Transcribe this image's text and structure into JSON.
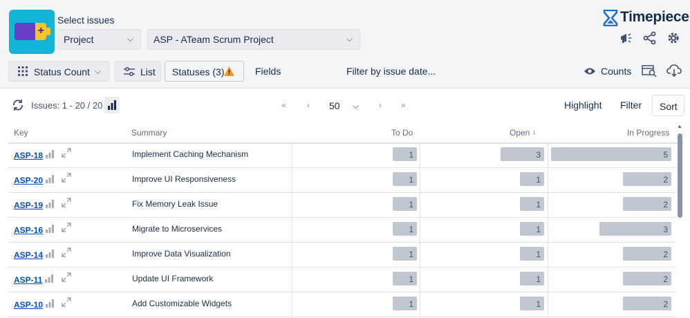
{
  "header": {
    "select_label": "Select issues",
    "project_dropdown": "Project",
    "project_value": "ASP - ATeam Scrum Project",
    "brand": "Timepiece"
  },
  "toolbar": {
    "status_count": "Status Count",
    "list": "List",
    "statuses": "Statuses (3)",
    "fields": "Fields",
    "filter_date": "Filter by issue date...",
    "counts": "Counts"
  },
  "pager": {
    "issues": "Issues: 1 - 20 / 20",
    "page_size": "50",
    "highlight": "Highlight",
    "filter": "Filter",
    "sort": "Sort"
  },
  "columns": {
    "key": "Key",
    "summary": "Summary",
    "todo": "To Do",
    "open": "Open",
    "in_progress": "In Progress"
  },
  "rows": [
    {
      "key": "ASP-18",
      "summary": "Implement Caching Mechanism",
      "todo": "1",
      "open": "3",
      "in_progress": "5"
    },
    {
      "key": "ASP-20",
      "summary": "Improve UI Responsiveness",
      "todo": "1",
      "open": "1",
      "in_progress": "2"
    },
    {
      "key": "ASP-19",
      "summary": "Fix Memory Leak Issue",
      "todo": "1",
      "open": "1",
      "in_progress": "2"
    },
    {
      "key": "ASP-16",
      "summary": "Migrate to Microservices",
      "todo": "1",
      "open": "1",
      "in_progress": "3"
    },
    {
      "key": "ASP-14",
      "summary": "Improve Data Visualization",
      "todo": "1",
      "open": "1",
      "in_progress": "2"
    },
    {
      "key": "ASP-11",
      "summary": "Update UI Framework",
      "todo": "1",
      "open": "1",
      "in_progress": "2"
    },
    {
      "key": "ASP-10",
      "summary": "Add Customizable Widgets",
      "todo": "1",
      "open": "1",
      "in_progress": "2"
    }
  ],
  "colors": {
    "accent": "#0052cc",
    "bar": "#c1c7d0",
    "warning": "#ff991f",
    "brand_icon": "#12b5d8"
  }
}
